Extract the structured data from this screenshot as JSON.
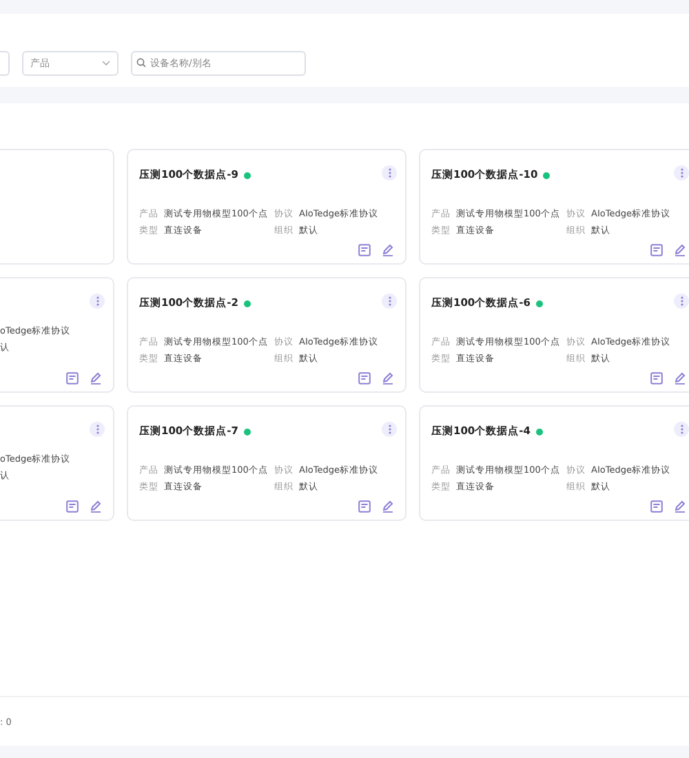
{
  "filters": {
    "product_select": {
      "value": "产品"
    },
    "search": {
      "placeholder": "设备名称/别名"
    }
  },
  "cards": [
    {
      "kind": "cut"
    },
    {
      "kind": "full",
      "title": "压测100个数据点-9",
      "online": true,
      "product_label": "产品",
      "product": "测试专用物模型100个点",
      "type_label": "类型",
      "type": "直连设备",
      "protocol_label": "协议",
      "protocol": "AIoTedge标准协议",
      "org_label": "组织",
      "org": "默认"
    },
    {
      "kind": "full",
      "title": "压测100个数据点-10",
      "online": true,
      "product_label": "产品",
      "product": "测试专用物模型100个点",
      "type_label": "类型",
      "type": "直连设备",
      "protocol_label": "协议",
      "protocol": "AIoTedge标准协议",
      "org_label": "组织",
      "org": "默认"
    },
    {
      "kind": "cut",
      "protocol": "oTedge标准协议",
      "org": "认"
    },
    {
      "kind": "full",
      "title": "压测100个数据点-2",
      "online": true,
      "product_label": "产品",
      "product": "测试专用物模型100个点",
      "type_label": "类型",
      "type": "直连设备",
      "protocol_label": "协议",
      "protocol": "AIoTedge标准协议",
      "org_label": "组织",
      "org": "默认"
    },
    {
      "kind": "full",
      "title": "压测100个数据点-6",
      "online": true,
      "product_label": "产品",
      "product": "测试专用物模型100个点",
      "type_label": "类型",
      "type": "直连设备",
      "protocol_label": "协议",
      "protocol": "AIoTedge标准协议",
      "org_label": "组织",
      "org": "默认"
    },
    {
      "kind": "cut",
      "protocol": "oTedge标准协议",
      "org": "认"
    },
    {
      "kind": "full",
      "title": "压测100个数据点-7",
      "online": true,
      "product_label": "产品",
      "product": "测试专用物模型100个点",
      "type_label": "类型",
      "type": "直连设备",
      "protocol_label": "协议",
      "protocol": "AIoTedge标准协议",
      "org_label": "组织",
      "org": "默认"
    },
    {
      "kind": "full",
      "title": "压测100个数据点-4",
      "online": true,
      "product_label": "产品",
      "product": "测试专用物模型100个点",
      "type_label": "类型",
      "type": "直连设备",
      "protocol_label": "协议",
      "protocol": "AIoTedge标准协议",
      "org_label": "组织",
      "org": "默认"
    }
  ],
  "footer": {
    "total": ": 0"
  }
}
